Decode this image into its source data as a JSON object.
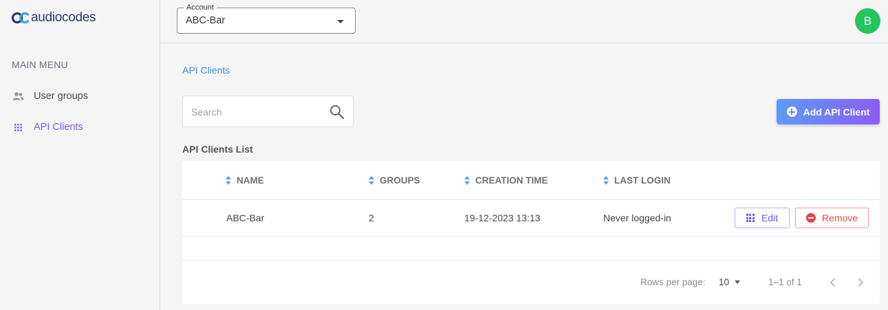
{
  "brand": {
    "name": "audiocodes",
    "color": "#2b3a67",
    "accent": "#7c5cf0"
  },
  "sidebar": {
    "menu_title": "MAIN MENU",
    "items": [
      {
        "label": "User groups",
        "icon": "users-icon",
        "active": false
      },
      {
        "label": "API Clients",
        "icon": "grid-icon",
        "active": true
      }
    ]
  },
  "header": {
    "account": {
      "legend": "Account",
      "value": "ABC-Bar"
    },
    "avatar_initial": "B",
    "avatar_color": "#22c55e"
  },
  "main": {
    "breadcrumb": "API Clients",
    "search": {
      "placeholder": "Search",
      "value": ""
    },
    "add_button_label": "Add API Client",
    "list_title": "API Clients List",
    "table": {
      "columns": [
        "NAME",
        "GROUPS",
        "CREATION TIME",
        "LAST LOGIN"
      ],
      "rows": [
        {
          "name": "ABC-Bar",
          "groups": "2",
          "creation_time": "19-12-2023 13:13",
          "last_login": "Never logged-in"
        }
      ],
      "edit_label": "Edit",
      "remove_label": "Remove"
    },
    "pagination": {
      "rows_per_page_label": "Rows per page:",
      "rows_per_page": "10",
      "range": "1–1 of 1"
    }
  }
}
